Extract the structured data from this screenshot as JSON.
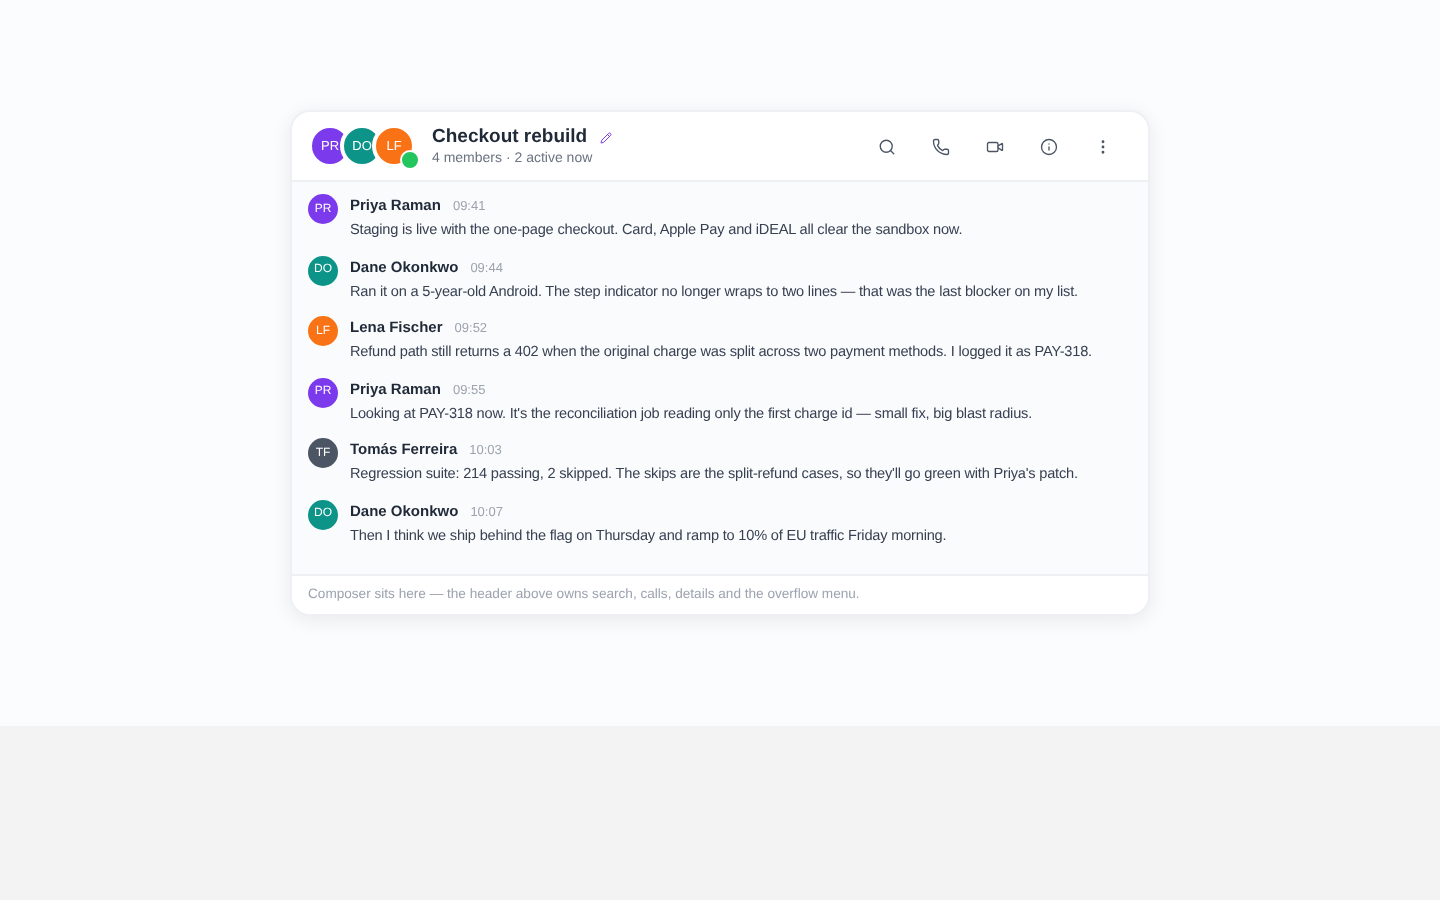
{
  "header": {
    "title": "Checkout rebuild",
    "subtitle": "4 members · 2 active now",
    "members": [
      {
        "initials": "PR",
        "color": "#7c3aed"
      },
      {
        "initials": "DO",
        "color": "#0d9488"
      },
      {
        "initials": "LF",
        "color": "#f97316"
      }
    ],
    "online": true
  },
  "messages": [
    {
      "initials": "PR",
      "color": "#7c3aed",
      "author": "Priya Raman",
      "time": "09:41",
      "text": "Staging is live with the one-page checkout. Card, Apple Pay and iDEAL all clear the sandbox now."
    },
    {
      "initials": "DO",
      "color": "#0d9488",
      "author": "Dane Okonkwo",
      "time": "09:44",
      "text": "Ran it on a 5-year-old Android. The step indicator no longer wraps to two lines — that was the last blocker on my list."
    },
    {
      "initials": "LF",
      "color": "#f97316",
      "author": "Lena Fischer",
      "time": "09:52",
      "text": "Refund path still returns a 402 when the original charge was split across two payment methods. I logged it as PAY-318."
    },
    {
      "initials": "PR",
      "color": "#7c3aed",
      "author": "Priya Raman",
      "time": "09:55",
      "text": "Looking at PAY-318 now. It's the reconciliation job reading only the first charge id — small fix, big blast radius."
    },
    {
      "initials": "TF",
      "color": "#4b5563",
      "author": "Tomás Ferreira",
      "time": "10:03",
      "text": "Regression suite: 214 passing, 2 skipped. The skips are the split-refund cases, so they'll go green with Priya's patch."
    },
    {
      "initials": "DO",
      "color": "#0d9488",
      "author": "Dane Okonkwo",
      "time": "10:07",
      "text": "Then I think we ship behind the flag on Thursday and ramp to 10% of EU traffic Friday morning."
    }
  ],
  "composer": {
    "placeholder": "Composer sits here — the header above owns search, calls, details and the overflow menu."
  }
}
